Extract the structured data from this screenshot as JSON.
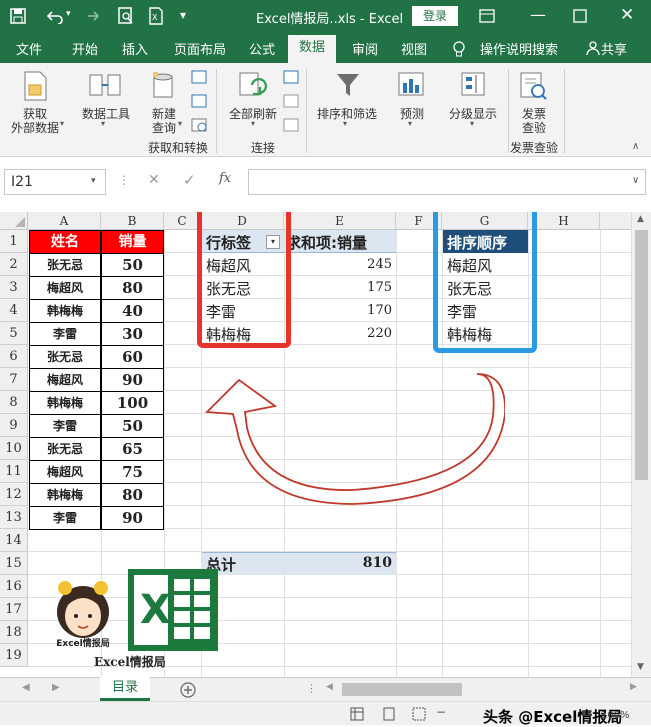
{
  "window": {
    "title": "Excel情报局..xls - Excel",
    "login_label": "登录"
  },
  "ribbon_tabs": [
    "文件",
    "开始",
    "插入",
    "页面布局",
    "公式",
    "数据",
    "审阅",
    "视图"
  ],
  "tell_me": "操作说明搜索",
  "share": "共享",
  "ribbon": {
    "get_data": [
      "获取",
      "外部数据"
    ],
    "data_tools": "数据工具",
    "new_query": [
      "新建",
      "查询"
    ],
    "group_get_transform": "获取和转换",
    "refresh_all": "全部刷新",
    "group_connections": "连接",
    "sort_filter": "排序和筛选",
    "forecast": "预测",
    "outline": "分级显示",
    "invoice": [
      "发票",
      "查验"
    ],
    "group_invoice": "发票查验"
  },
  "formula_bar": {
    "name_box": "I21",
    "fx_label": "fx",
    "formula": ""
  },
  "columns": [
    "A",
    "B",
    "C",
    "D",
    "E",
    "F",
    "G",
    "H"
  ],
  "rows": [
    "1",
    "2",
    "3",
    "4",
    "5",
    "6",
    "7",
    "8",
    "9",
    "10",
    "11",
    "12",
    "13",
    "14",
    "15",
    "16",
    "17",
    "18",
    "19"
  ],
  "source_table": {
    "headers": [
      "姓名",
      "销量"
    ],
    "rows": [
      [
        "张无忌",
        "50"
      ],
      [
        "梅超风",
        "80"
      ],
      [
        "韩梅梅",
        "40"
      ],
      [
        "李雷",
        "30"
      ],
      [
        "张无忌",
        "60"
      ],
      [
        "梅超风",
        "90"
      ],
      [
        "韩梅梅",
        "100"
      ],
      [
        "李雷",
        "50"
      ],
      [
        "张无忌",
        "65"
      ],
      [
        "梅超风",
        "75"
      ],
      [
        "韩梅梅",
        "80"
      ],
      [
        "李雷",
        "90"
      ]
    ]
  },
  "pivot": {
    "row_label": "行标签",
    "value_label": "求和项:销量",
    "rows": [
      [
        "梅超风",
        "245"
      ],
      [
        "张无忌",
        "175"
      ],
      [
        "李雷",
        "170"
      ],
      [
        "韩梅梅",
        "220"
      ]
    ],
    "total_label": "总计",
    "total_value": "810"
  },
  "sort_order": {
    "header": "排序顺序",
    "items": [
      "梅超风",
      "张无忌",
      "李雷",
      "韩梅梅"
    ]
  },
  "logo": {
    "caption": "Excel情报局",
    "badge": "Excel情报局"
  },
  "sheet_tab": "目录",
  "status": {
    "watermark": "头条 @Excel情报局",
    "zoom": "100%"
  },
  "colors": {
    "excel_green": "#217346",
    "header_red": "#ff0000",
    "pivot_header_blue": "#dce6f1",
    "sort_header_blue": "#1f4e79",
    "red_box": "#e8332a",
    "blue_box": "#2b9ae0",
    "arrow": "#c0392b"
  }
}
